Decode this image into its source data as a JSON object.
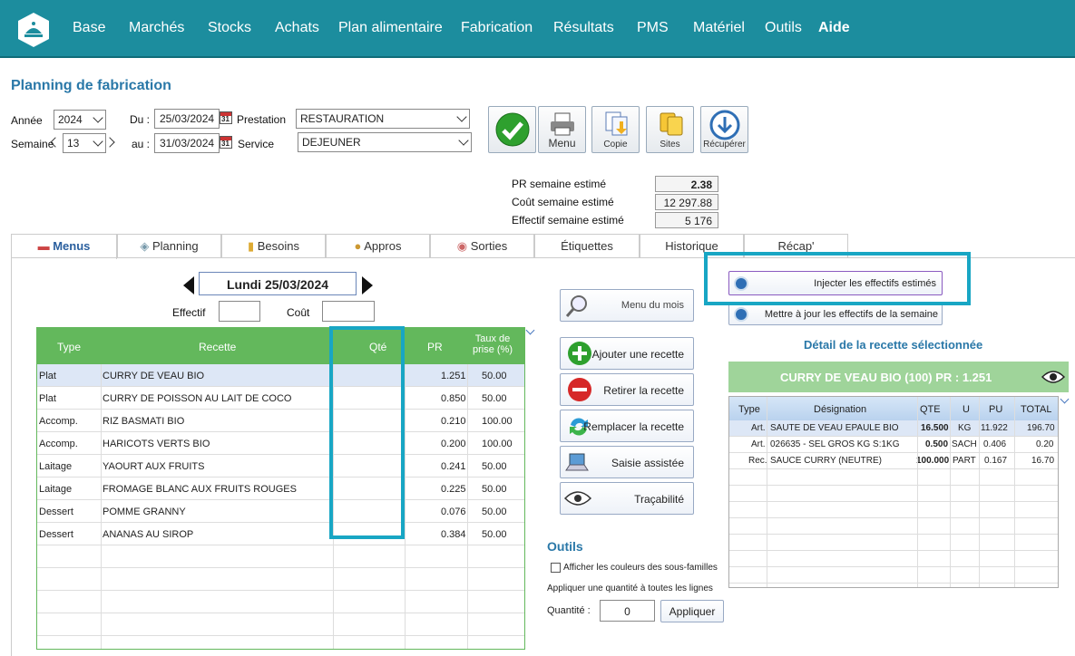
{
  "nav": [
    "Base",
    "Marchés",
    "Stocks",
    "Achats",
    "Plan alimentaire",
    "Fabrication",
    "Résultats",
    "PMS",
    "Matériel",
    "Outils",
    "Aide"
  ],
  "page_title": "Planning de fabrication",
  "form": {
    "annee_label": "Année",
    "annee": "2024",
    "semaine_label": "Semaine",
    "semaine": "13",
    "du_label": "Du :",
    "du": "25/03/2024",
    "au_label": "au :",
    "au": "31/03/2024",
    "prestation_label": "Prestation",
    "prestation": "RESTAURATION",
    "service_label": "Service",
    "service": "DEJEUNER",
    "cal": "31"
  },
  "toolbar": {
    "menu": "Menu",
    "copie": "Copie",
    "sites": "Sites",
    "recuperer": "Récupérer"
  },
  "stats": [
    {
      "label": "PR semaine estimé",
      "value": "2.38"
    },
    {
      "label": "Coût semaine estimé",
      "value": "12 297.88"
    },
    {
      "label": "Effectif semaine estimé",
      "value": "5 176"
    }
  ],
  "tabs": [
    "Menus",
    "Planning",
    "Besoins",
    "Appros",
    "Sorties",
    "Étiquettes",
    "Historique",
    "Récap'"
  ],
  "day": "Lundi 25/03/2024",
  "effectif_label": "Effectif",
  "cout_label": "Coût",
  "grid": {
    "headers": {
      "type": "Type",
      "recette": "Recette",
      "qte": "Qté",
      "pr": "PR",
      "taux": "Taux de prise (%)"
    },
    "rows": [
      {
        "type": "Plat",
        "recette": "CURRY DE VEAU BIO",
        "pr": "1.251",
        "taux": "50.00"
      },
      {
        "type": "Plat",
        "recette": "CURRY DE POISSON AU LAIT DE COCO",
        "pr": "0.850",
        "taux": "50.00"
      },
      {
        "type": "Accomp.",
        "recette": "RIZ BASMATI BIO",
        "pr": "0.210",
        "taux": "100.00"
      },
      {
        "type": "Accomp.",
        "recette": "HARICOTS VERTS BIO",
        "pr": "0.200",
        "taux": "100.00"
      },
      {
        "type": "Laitage",
        "recette": "YAOURT AUX FRUITS",
        "pr": "0.241",
        "taux": "50.00"
      },
      {
        "type": "Laitage",
        "recette": "FROMAGE BLANC AUX FRUITS ROUGES",
        "pr": "0.225",
        "taux": "50.00"
      },
      {
        "type": "Dessert",
        "recette": "POMME GRANNY",
        "pr": "0.076",
        "taux": "50.00"
      },
      {
        "type": "Dessert",
        "recette": "ANANAS AU SIROP",
        "pr": "0.384",
        "taux": "50.00"
      }
    ]
  },
  "actions": {
    "menu_mois": "Menu du mois",
    "ajouter": "Ajouter une recette",
    "retirer": "Retirer la recette",
    "remplacer": "Remplacer la recette",
    "saisie": "Saisie assistée",
    "tracabilite": "Traçabilité"
  },
  "outils": {
    "title": "Outils",
    "checkbox": "Afficher les couleurs des sous-familles",
    "apply_text": "Appliquer une quantité à toutes les lignes",
    "quantite_label": "Quantité :",
    "quantite": "0",
    "appliquer": "Appliquer"
  },
  "right": {
    "injecter": "Injecter les effectifs estimés",
    "mettre": "Mettre à jour les effectifs  de la semaine",
    "detail_title": "Détail de la recette sélectionnée",
    "banner": "CURRY DE VEAU BIO (100) PR : 1.251"
  },
  "detail": {
    "headers": {
      "type": "Type",
      "designation": "Désignation",
      "qte": "QTE",
      "u": "U",
      "pu": "PU",
      "total": "TOTAL"
    },
    "rows": [
      {
        "type": "Art.",
        "designation": "SAUTE DE VEAU EPAULE BIO",
        "qte": "16.500",
        "u": "KG",
        "pu": "11.922",
        "total": "196.70"
      },
      {
        "type": "Art.",
        "designation": "026635 - SEL GROS KG S:1KG",
        "qte": "0.500",
        "u": "SACH",
        "pu": "0.406",
        "total": "0.20"
      },
      {
        "type": "Rec.",
        "designation": "SAUCE CURRY (NEUTRE)",
        "qte": "100.000",
        "u": "PART",
        "pu": "0.167",
        "total": "16.70"
      }
    ]
  },
  "colors": {
    "topbar": "#1c8d9e",
    "grid_header": "#63b85c",
    "banner": "#9fd49a",
    "highlight": "#18a6c4",
    "title": "#2a78a8"
  }
}
